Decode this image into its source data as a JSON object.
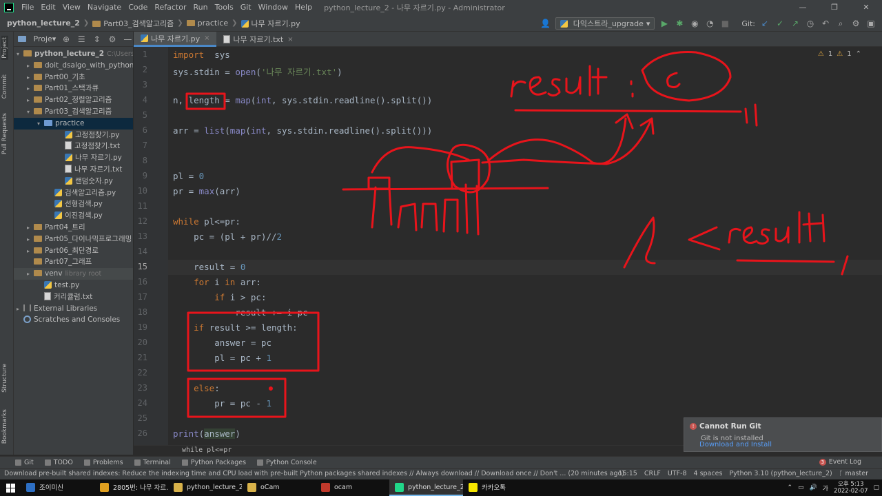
{
  "menubar": {
    "items": [
      "File",
      "Edit",
      "View",
      "Navigate",
      "Code",
      "Refactor",
      "Run",
      "Tools",
      "Git",
      "Window",
      "Help"
    ],
    "window_title": "python_lecture_2 - 나무 자르기.py - Administrator"
  },
  "navbar": {
    "crumbs": [
      "python_lecture_2",
      "Part03_검색알고리즘",
      "practice",
      "나무 자르기.py"
    ],
    "run_config": "다익스트라_upgrade",
    "git_label": "Git:"
  },
  "stripe": {
    "project": "Project",
    "commit": "Commit",
    "pull_requests": "Pull Requests",
    "structure": "Structure",
    "bookmarks": "Bookmarks"
  },
  "project_panel": {
    "header": "Proje▾",
    "tree": [
      {
        "label": "python_lecture_2",
        "extra": "C:\\Users\\A",
        "indent": 0,
        "arrow": "▾",
        "type": "folder",
        "bold": true
      },
      {
        "label": "doit_dsalgo_with_python",
        "indent": 1,
        "arrow": "▸",
        "type": "folder"
      },
      {
        "label": "Part00_기초",
        "indent": 1,
        "arrow": "▸",
        "type": "folder"
      },
      {
        "label": "Part01_스택과큐",
        "indent": 1,
        "arrow": "▸",
        "type": "folder"
      },
      {
        "label": "Part02_정렬알고리즘",
        "indent": 1,
        "arrow": "▸",
        "type": "folder"
      },
      {
        "label": "Part03_검색알고리즘",
        "indent": 1,
        "arrow": "▾",
        "type": "folder"
      },
      {
        "label": "practice",
        "indent": 2,
        "arrow": "▾",
        "type": "folder",
        "selected": true
      },
      {
        "label": "고정점찾기.py",
        "indent": 4,
        "arrow": "",
        "type": "py"
      },
      {
        "label": "고정점찾기.txt",
        "indent": 4,
        "arrow": "",
        "type": "txt"
      },
      {
        "label": "나무 자르기.py",
        "indent": 4,
        "arrow": "",
        "type": "py"
      },
      {
        "label": "나무 자르기.txt",
        "indent": 4,
        "arrow": "",
        "type": "txt"
      },
      {
        "label": "랜덤숫자.py",
        "indent": 4,
        "arrow": "",
        "type": "py"
      },
      {
        "label": "검색알고리즘.py",
        "indent": 3,
        "arrow": "",
        "type": "py"
      },
      {
        "label": "선형검색.py",
        "indent": 3,
        "arrow": "",
        "type": "py"
      },
      {
        "label": "이진검색.py",
        "indent": 3,
        "arrow": "",
        "type": "py"
      },
      {
        "label": "Part04_트리",
        "indent": 1,
        "arrow": "▸",
        "type": "folder"
      },
      {
        "label": "Part05_다이나믹프로그래밍",
        "indent": 1,
        "arrow": "▸",
        "type": "folder"
      },
      {
        "label": "Part06_최단경로",
        "indent": 1,
        "arrow": "▸",
        "type": "folder"
      },
      {
        "label": "Part07_그래프",
        "indent": 1,
        "arrow": "",
        "type": "folder"
      },
      {
        "label": "venv",
        "extra": "library root",
        "indent": 1,
        "arrow": "▸",
        "type": "folder",
        "venv": true
      },
      {
        "label": "test.py",
        "indent": 2,
        "arrow": "",
        "type": "py"
      },
      {
        "label": "커리큘럼.txt",
        "indent": 2,
        "arrow": "",
        "type": "txt"
      },
      {
        "label": "External Libraries",
        "indent": 0,
        "arrow": "▸",
        "type": "lib"
      },
      {
        "label": "Scratches and Consoles",
        "indent": 0,
        "arrow": "",
        "type": "scratch"
      }
    ]
  },
  "editor_tabs": [
    {
      "label": "나무 자르기.py",
      "active": true,
      "type": "py"
    },
    {
      "label": "나무 자르기.txt",
      "active": false,
      "type": "txt"
    }
  ],
  "inspection": {
    "warnings": "1",
    "weak": "1"
  },
  "editor": {
    "current_line": 15,
    "lines": [
      [
        [
          "kw",
          "import"
        ],
        [
          "",
          "  sys"
        ]
      ],
      [
        [
          "",
          "sys.stdin = "
        ],
        [
          "fn",
          "open"
        ],
        [
          "",
          "("
        ],
        [
          "str",
          "'나무 자르기.txt'"
        ],
        [
          "",
          ")"
        ]
      ],
      [],
      [
        [
          "",
          "n, length = "
        ],
        [
          "fn",
          "map"
        ],
        [
          "",
          "("
        ],
        [
          "fn",
          "int"
        ],
        [
          "",
          ", sys.stdin.readline().split())"
        ]
      ],
      [],
      [
        [
          "",
          "arr = "
        ],
        [
          "fn",
          "list"
        ],
        [
          "",
          "("
        ],
        [
          "fn",
          "map"
        ],
        [
          "",
          "("
        ],
        [
          "fn",
          "int"
        ],
        [
          "",
          ", sys.stdin.readline().split()))"
        ]
      ],
      [],
      [],
      [
        [
          "",
          "pl = "
        ],
        [
          "num",
          "0"
        ]
      ],
      [
        [
          "",
          "pr = "
        ],
        [
          "fn",
          "max"
        ],
        [
          "",
          "(arr)"
        ]
      ],
      [],
      [
        [
          "kw",
          "while"
        ],
        [
          "",
          " pl<=pr:"
        ]
      ],
      [
        [
          "",
          "    pc = (pl + pr)//"
        ],
        [
          "num",
          "2"
        ]
      ],
      [],
      [
        [
          "",
          "    result = "
        ],
        [
          "num",
          "0"
        ]
      ],
      [
        [
          "",
          "    "
        ],
        [
          "kw",
          "for"
        ],
        [
          "",
          " i "
        ],
        [
          "kw",
          "in"
        ],
        [
          "",
          " arr:"
        ]
      ],
      [
        [
          "",
          "        "
        ],
        [
          "kw",
          "if"
        ],
        [
          "",
          " i > pc:"
        ]
      ],
      [
        [
          "",
          "            result += i-pc"
        ]
      ],
      [
        [
          "",
          "    "
        ],
        [
          "kw",
          "if"
        ],
        [
          "",
          " result >= length:"
        ]
      ],
      [
        [
          "",
          "        answer = pc"
        ]
      ],
      [
        [
          "",
          "        pl = pc + "
        ],
        [
          "num",
          "1"
        ]
      ],
      [],
      [
        [
          "",
          "    "
        ],
        [
          "kw",
          "else"
        ],
        [
          "",
          ":"
        ]
      ],
      [
        [
          "",
          "        pr = pc - "
        ],
        [
          "num",
          "1"
        ]
      ],
      [],
      [
        [
          "fn",
          "print"
        ],
        [
          "",
          "("
        ],
        [
          "hl",
          "answer"
        ],
        [
          "",
          ")"
        ]
      ]
    ]
  },
  "code_crumb": "while pl<=pr",
  "bottom_tools": [
    "Git",
    "TODO",
    "Problems",
    "Terminal",
    "Python Packages",
    "Python Console"
  ],
  "event_log": {
    "label": "Event Log",
    "count": "3"
  },
  "status": {
    "message": "Download pre-built shared indexes: Reduce the indexing time and CPU load with pre-built Python packages shared indexes // Always download // Download once // Don't ... (20 minutes ago)",
    "position": "15:15",
    "line_sep": "CRLF",
    "encoding": "UTF-8",
    "indent": "4 spaces",
    "interpreter": "Python 3.10 (python_lecture_2)",
    "branch": "master"
  },
  "notification": {
    "title": "Cannot Run Git",
    "body": "Git is not installed",
    "link": "Download and Install"
  },
  "taskbar": {
    "tasks": [
      {
        "label": "조이미신",
        "color": "#2d6fc4"
      },
      {
        "label": "2805번: 나무 자르...",
        "color": "#e0a020"
      },
      {
        "label": "python_lecture_2",
        "color": "#d8b24a"
      },
      {
        "label": "oCam",
        "color": "#d8b24a"
      },
      {
        "label": "ocam",
        "color": "#c0392b"
      },
      {
        "label": "python_lecture_2 –...",
        "color": "#21d789",
        "active": true
      },
      {
        "label": "카카오톡",
        "color": "#f7e600"
      }
    ],
    "clock_ampm": "오후 5:13",
    "clock_date": "2022-02-07"
  },
  "annotations": {
    "color": "#e8141b",
    "text_top": "result : c",
    "text_bottom": "l < result"
  }
}
